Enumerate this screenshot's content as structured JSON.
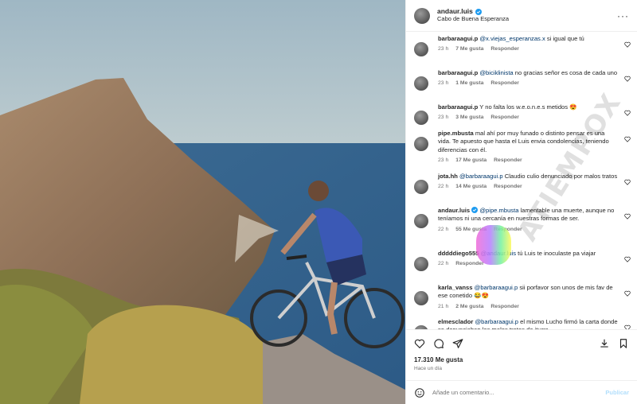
{
  "post": {
    "username": "andaur.luis",
    "location": "Cabo de Buena Esperanza",
    "likes": "17.310 Me gusta",
    "time_ago": "Hace un día",
    "add_comment_placeholder": "Añade un comentario...",
    "publish_label": "Publicar"
  },
  "comments": [
    {
      "user": "barbaraagui.p",
      "mention": "@x.viejas_esperanzas.x",
      "text": " si igual que tú",
      "time": "23 h",
      "likes": "7 Me gusta",
      "reply": "Responder"
    },
    {
      "user": "barbaraagui.p",
      "mention": "@biciklinista",
      "text": " no gracias señor es cosa de cada uno",
      "time": "23 h",
      "likes": "1 Me gusta",
      "reply": "Responder"
    },
    {
      "user": "barbaraagui.p",
      "mention": "",
      "text": "Y no falta los w.e.o.n.e.s metidos 😍",
      "time": "23 h",
      "likes": "3 Me gusta",
      "reply": "Responder"
    },
    {
      "user": "pipe.mbusta",
      "mention": "",
      "text": "mal ahí por muy funado o distinto pensar es una vida. Te apuesto que hasta el Luis envia condolencias, teniendo diferencias con él.",
      "time": "23 h",
      "likes": "17 Me gusta",
      "reply": "Responder"
    },
    {
      "user": "jota.hh",
      "mention": "@barbaraagui.p",
      "text": " Claudio culio denunciado por malos tratos",
      "time": "22 h",
      "likes": "14 Me gusta",
      "reply": "Responder"
    },
    {
      "user": "andaur.luis",
      "mention": "@pipe.mbusta",
      "text": " lamentable una muerte, aunque no teníamos ni una cercanía en nuestras formas de ser.",
      "time": "22 h",
      "likes": "55 Me gusta",
      "reply": "Responder",
      "verified": true
    },
    {
      "user": "dddddiego555",
      "mention": "@andaur.luis",
      "text": " tú Luis te inoculaste pa viajar",
      "time": "22 h",
      "likes": "",
      "reply": "Responder"
    },
    {
      "user": "karla_vanss",
      "mention": "@barbaraagui.p",
      "text": " sii porfavor son unos de mis fav de ese conetido 😂😍",
      "time": "21 h",
      "likes": "2 Me gusta",
      "reply": "Responder"
    },
    {
      "user": "elmesclador",
      "mention": "@barbaraagui.p",
      "text": " el mismo Lucho firmó la carta donde se denunciaban los malos tratos de iturra",
      "time": "",
      "likes": "",
      "reply": ""
    }
  ],
  "watermark": "ATIEMPOX",
  "colors": {
    "mention": "#00376b",
    "muted": "#737373",
    "verified": "#1d9bf0"
  }
}
